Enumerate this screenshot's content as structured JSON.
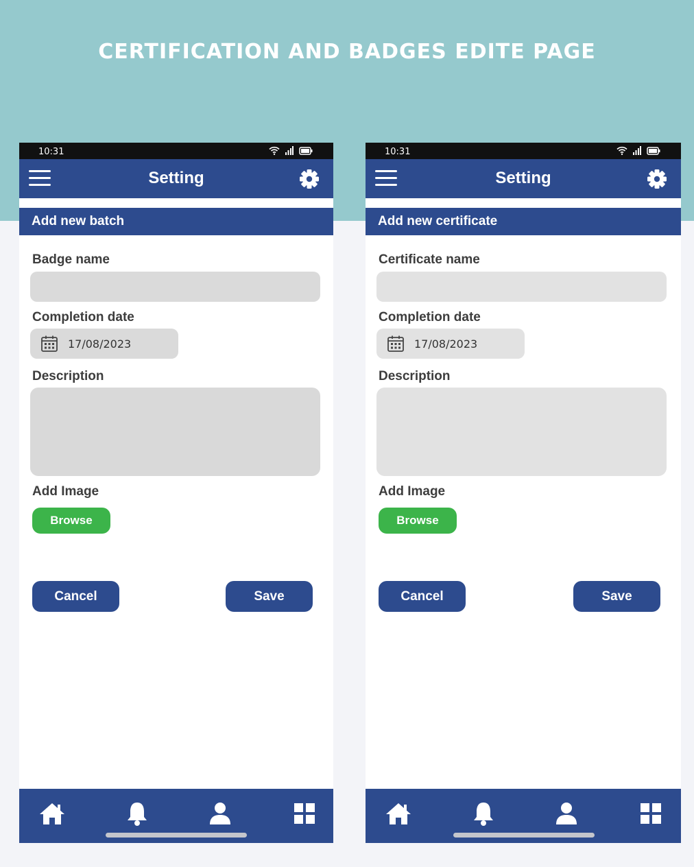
{
  "page": {
    "title": "CERTIFICATION AND BADGES EDITE PAGE"
  },
  "colors": {
    "banner": "#95c9cd",
    "primary": "#2d4b8e",
    "browse": "#3cb44a",
    "field": "#dadada"
  },
  "badge_screen": {
    "status": {
      "time": "10:31"
    },
    "app_bar": {
      "title": "Setting"
    },
    "section_title": "Add new batch",
    "name_label": "Badge name",
    "name_value": "",
    "date_label": "Completion date",
    "date_value": "17/08/2023",
    "description_label": "Description",
    "description_value": "",
    "image_label": "Add Image",
    "browse_label": "Browse",
    "cancel_label": "Cancel",
    "save_label": "Save"
  },
  "certificate_screen": {
    "status": {
      "time": "10:31"
    },
    "app_bar": {
      "title": "Setting"
    },
    "section_title": "Add new certificate",
    "name_label": "Certificate name",
    "name_value": "",
    "date_label": "Completion date",
    "date_value": "17/08/2023",
    "description_label": "Description",
    "description_value": "",
    "image_label": "Add Image",
    "browse_label": "Browse",
    "cancel_label": "Cancel",
    "save_label": "Save"
  },
  "icons": {
    "menu": "hamburger-menu-icon",
    "settings": "gear-icon",
    "calendar": "calendar-icon",
    "nav": [
      "home-icon",
      "bell-icon",
      "user-icon",
      "grid-icon"
    ],
    "status": [
      "wifi-icon",
      "signal-icon",
      "battery-icon"
    ]
  }
}
